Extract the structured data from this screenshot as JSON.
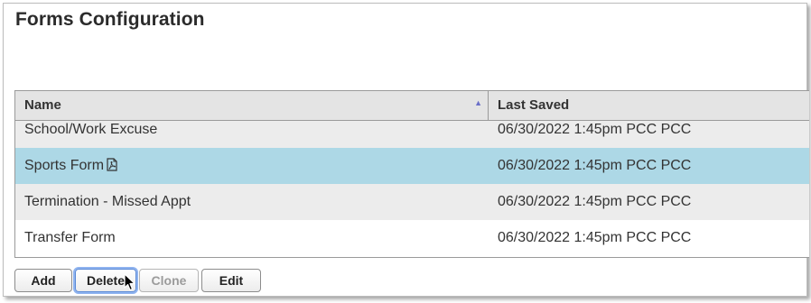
{
  "page": {
    "title": "Forms Configuration"
  },
  "grid": {
    "columns": [
      {
        "label": "Name",
        "sort": "ascending"
      },
      {
        "label": "Last Saved"
      }
    ],
    "rows": [
      {
        "name": "School/Work Excuse",
        "last_saved": "06/30/2022 1:45pm PCC PCC",
        "selected": false,
        "pdf": false
      },
      {
        "name": "Sports Form",
        "last_saved": "06/30/2022 1:45pm PCC PCC",
        "selected": true,
        "pdf": true
      },
      {
        "name": "Termination - Missed Appt",
        "last_saved": "06/30/2022 1:45pm PCC PCC",
        "selected": false,
        "pdf": false
      },
      {
        "name": "Transfer Form",
        "last_saved": "06/30/2022 1:45pm PCC PCC",
        "selected": false,
        "pdf": false
      }
    ]
  },
  "buttons": {
    "add": "Add",
    "delete": "Delete",
    "clone": "Clone",
    "edit": "Edit"
  },
  "colors": {
    "selected_row": "#add8e6",
    "alt_row": "#ececec",
    "header": "#e4e4e4",
    "sort_arrow": "#6a6fc8"
  }
}
